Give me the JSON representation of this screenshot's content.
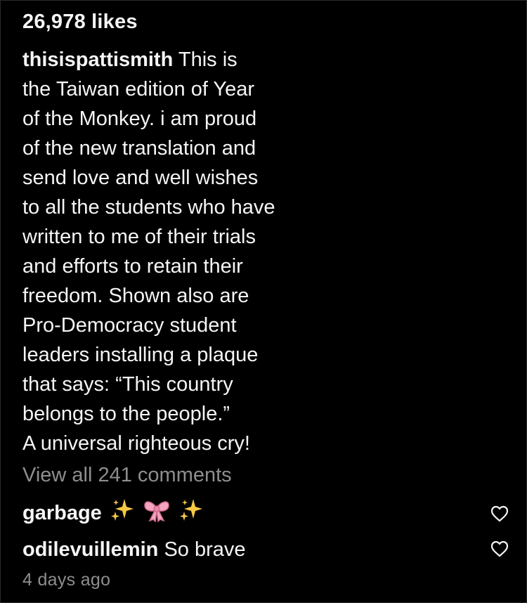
{
  "post": {
    "likes": "26,978 likes",
    "caption_user": "thisispattismith",
    "caption_lines": [
      "This is",
      "the Taiwan edition of Year",
      "of the Monkey. i am proud",
      "of the new translation and",
      "send love and well wishes",
      "to all the students who have",
      "written to me of their trials",
      "and efforts to retain their",
      "freedom. Shown also are",
      "Pro-Democracy student",
      "leaders installing a plaque",
      "that says: “This country",
      "belongs to the people.”",
      "A universal righteous cry!"
    ],
    "view_all_comments": "View all 241 comments",
    "comments": [
      {
        "user": "garbage",
        "text": "",
        "emoji": [
          "sparkles-icon",
          "ribbon-icon",
          "sparkles-icon"
        ]
      },
      {
        "user": "odilevuillemin",
        "text": "So brave"
      }
    ],
    "timestamp": "4 days ago"
  },
  "colors": {
    "background": "#000000",
    "text": "#f5f5f5",
    "muted": "#8e8e8e",
    "sparkle": "#f6c945",
    "ribbon": "#f4a6c0"
  }
}
